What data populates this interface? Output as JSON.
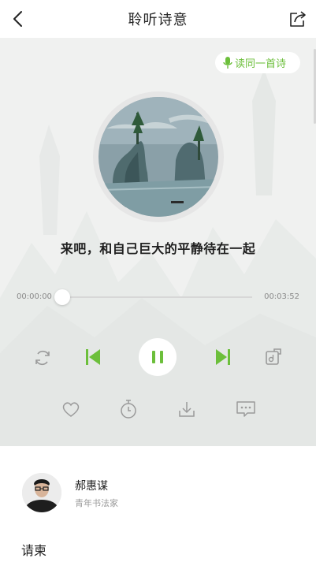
{
  "header": {
    "title": "聆听诗意"
  },
  "player": {
    "read_button_label": "读同一首诗",
    "poem_line": "来吧，和自己巨大的平静待在一起",
    "current_time": "00:00:00",
    "total_time": "00:03:52",
    "progress": 0.0,
    "is_playing": true,
    "accent_color": "#6cbf3b"
  },
  "icons": {
    "back": "chevron-left-icon",
    "share": "share-icon",
    "mic": "mic-icon",
    "loop": "repeat-icon",
    "prev": "skip-previous-icon",
    "pause": "pause-icon",
    "next": "skip-next-icon",
    "plate": "music-plate-icon",
    "heart": "heart-icon",
    "timer": "timer-icon",
    "download": "download-icon",
    "comment": "comment-icon"
  },
  "author": {
    "name": "郝惠谋",
    "title": "青年书法家"
  },
  "footer_text": "请柬"
}
